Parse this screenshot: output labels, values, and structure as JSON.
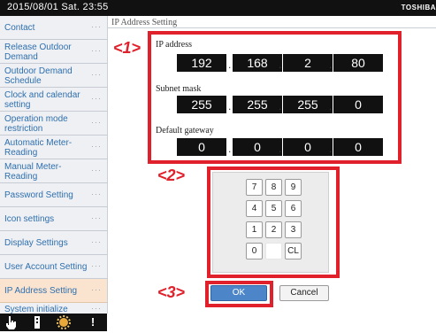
{
  "topbar": {
    "datetime": "2015/08/01 Sat.  23:55",
    "brand": "TOSHIBA"
  },
  "page_title": "IP Address Setting",
  "sidebar": {
    "dots": "···",
    "items": [
      {
        "label": "Contact"
      },
      {
        "label": "Release Outdoor Demand"
      },
      {
        "label": "Outdoor Demand Schedule"
      },
      {
        "label": "Clock and calendar setting"
      },
      {
        "label": "Operation mode restriction"
      },
      {
        "label": "Automatic Meter-Reading"
      },
      {
        "label": "Manual Meter-Reading"
      },
      {
        "label": "Password Setting"
      },
      {
        "label": "Icon settings"
      },
      {
        "label": "Display Settings"
      },
      {
        "label": "User Account Setting"
      },
      {
        "label": "IP Address Setting"
      },
      {
        "label": "System initialize"
      }
    ],
    "active_index": 11
  },
  "bottom_icons": [
    "hand-pointer-icon",
    "building-icon",
    "sun-gear-icon",
    "exclamation-icon"
  ],
  "callouts": {
    "c1": "<1>",
    "c2": "<2>",
    "c3": "<3>"
  },
  "fields": {
    "ip": {
      "label": "IP address",
      "octets": [
        "192",
        "168",
        "2",
        "80"
      ]
    },
    "subnet": {
      "label": "Subnet mask",
      "octets": [
        "255",
        "255",
        "255",
        "0"
      ]
    },
    "gateway": {
      "label": "Default gateway",
      "octets": [
        "0",
        "0",
        "0",
        "0"
      ]
    },
    "separator": "."
  },
  "keypad": {
    "rows": [
      [
        "7",
        "8",
        "9"
      ],
      [
        "4",
        "5",
        "6"
      ],
      [
        "1",
        "2",
        "3"
      ],
      [
        "0",
        "",
        "CL"
      ]
    ]
  },
  "buttons": {
    "ok": "OK",
    "cancel": "Cancel"
  },
  "colors": {
    "accent_red": "#e0202a",
    "ok_blue": "#4d86c8",
    "active_item": "#fbe4cf",
    "link_blue": "#2f6fae"
  }
}
